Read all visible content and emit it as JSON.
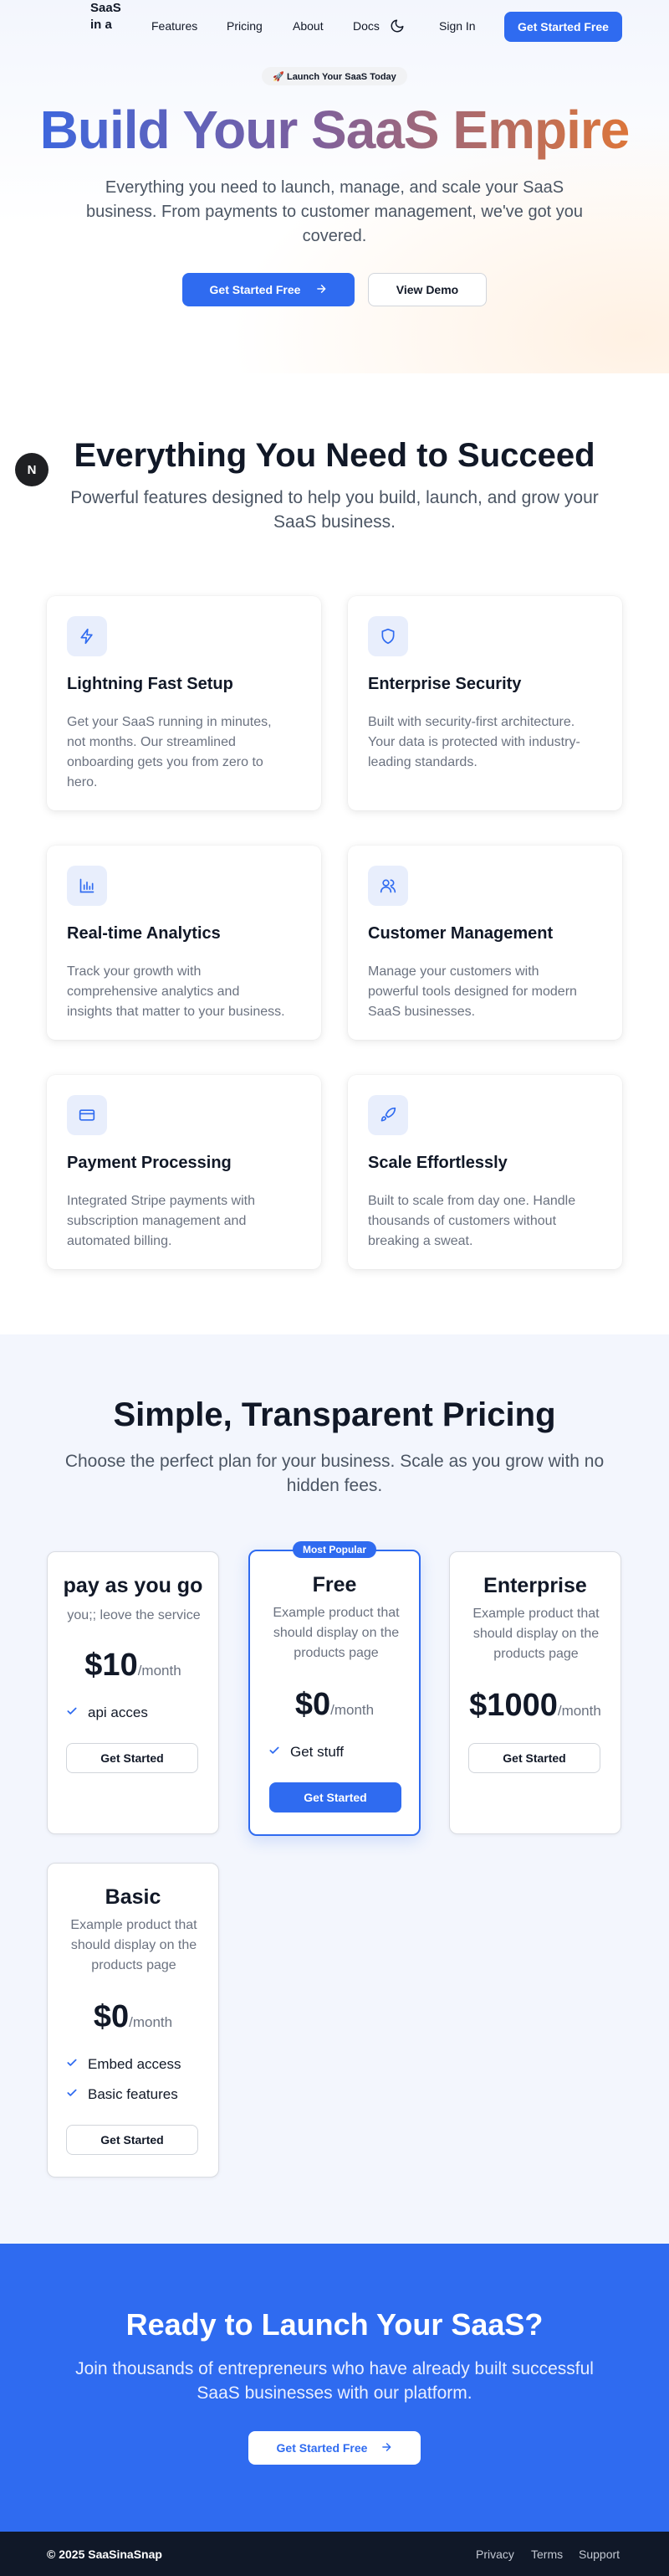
{
  "nav": {
    "logo": "SaaS in a",
    "links": [
      "Features",
      "Pricing",
      "About",
      "Docs"
    ],
    "theme_icon": "moon-icon",
    "sign_in": "Sign In",
    "cta": "Get Started Free"
  },
  "hero": {
    "badge": "🚀 Launch Your SaaS Today",
    "title": "Build Your SaaS Empire",
    "subtitle": "Everything you need to launch, manage, and scale your SaaS business. From payments to customer management, we've got you covered.",
    "primary_button": "Get Started Free",
    "secondary_button": "View Demo"
  },
  "features": {
    "badge_letter": "N",
    "title": "Everything You Need to Succeed",
    "subtitle": "Powerful features designed to help you build, launch, and grow your SaaS business.",
    "items": [
      {
        "icon": "lightning-icon",
        "title": "Lightning Fast Setup",
        "desc": "Get your SaaS running in minutes, not months. Our streamlined onboarding gets you from zero to hero."
      },
      {
        "icon": "shield-icon",
        "title": "Enterprise Security",
        "desc": "Built with security-first architecture. Your data is protected with industry-leading standards."
      },
      {
        "icon": "bar-chart-icon",
        "title": "Real-time Analytics",
        "desc": "Track your growth with comprehensive analytics and insights that matter to your business."
      },
      {
        "icon": "users-icon",
        "title": "Customer Management",
        "desc": "Manage your customers with powerful tools designed for modern SaaS businesses."
      },
      {
        "icon": "credit-card-icon",
        "title": "Payment Processing",
        "desc": "Integrated Stripe payments with subscription management and automated billing."
      },
      {
        "icon": "rocket-icon",
        "title": "Scale Effortlessly",
        "desc": "Built to scale from day one. Handle thousands of customers without breaking a sweat."
      }
    ]
  },
  "pricing": {
    "title": "Simple, Transparent Pricing",
    "subtitle": "Choose the perfect plan for your business. Scale as you grow with no hidden fees.",
    "popular_label": "Most Popular",
    "plans": [
      {
        "name": "pay as you go",
        "desc": "you;; leove the service",
        "price": "$10",
        "period": "/month",
        "features": [
          "api acces"
        ],
        "button": "Get Started"
      },
      {
        "name": "Free",
        "desc": "Example product that should display on the products page",
        "price": "$0",
        "period": "/month",
        "features": [
          "Get stuff"
        ],
        "button": "Get Started"
      },
      {
        "name": "Enterprise",
        "desc": "Example product that should display on the products page",
        "price": "$1000",
        "period": "/month",
        "features": [],
        "button": "Get Started"
      },
      {
        "name": "Basic",
        "desc": "Example product that should display on the products page",
        "price": "$0",
        "period": "/month",
        "features": [
          "Embed access",
          "Basic features"
        ],
        "button": "Get Started"
      }
    ]
  },
  "cta": {
    "title": "Ready to Launch Your SaaS?",
    "subtitle": "Join thousands of entrepreneurs who have already built successful SaaS businesses with our platform.",
    "button": "Get Started Free"
  },
  "footer": {
    "copyright": "© 2025 SaaSinaSnap",
    "links": [
      "Privacy",
      "Terms",
      "Support"
    ]
  },
  "colors": {
    "accent": "#2f6bf0",
    "footer_bg": "#101828",
    "pricing_bg": "#f3f6fd"
  }
}
